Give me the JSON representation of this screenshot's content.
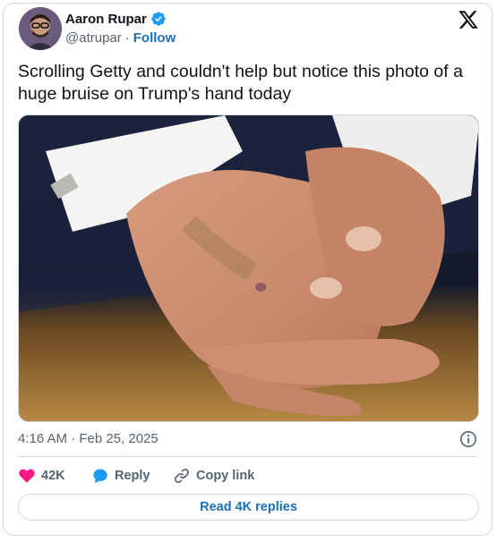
{
  "author": {
    "name": "Aaron Rupar",
    "handle": "@atrupar",
    "separator": "·",
    "follow_label": "Follow"
  },
  "tweet": {
    "text": "Scrolling Getty and couldn't help but notice this photo of a huge bruise on Trump's hand today",
    "timestamp": "4:16 AM · Feb 25, 2025"
  },
  "actions": {
    "likes_count": "42K",
    "reply_label": "Reply",
    "copy_link_label": "Copy link"
  },
  "replies_button_label": "Read 4K replies",
  "colors": {
    "like": "#f91880",
    "reply": "#1d9bf0",
    "link": "#1d6fb8",
    "verified": "#1d9bf0",
    "muted": "#536471"
  },
  "icons": {
    "verified": "verified-badge-icon",
    "logo": "x-logo-icon",
    "info": "info-icon",
    "like": "heart-icon",
    "reply": "speech-bubble-icon",
    "copy": "link-icon"
  }
}
